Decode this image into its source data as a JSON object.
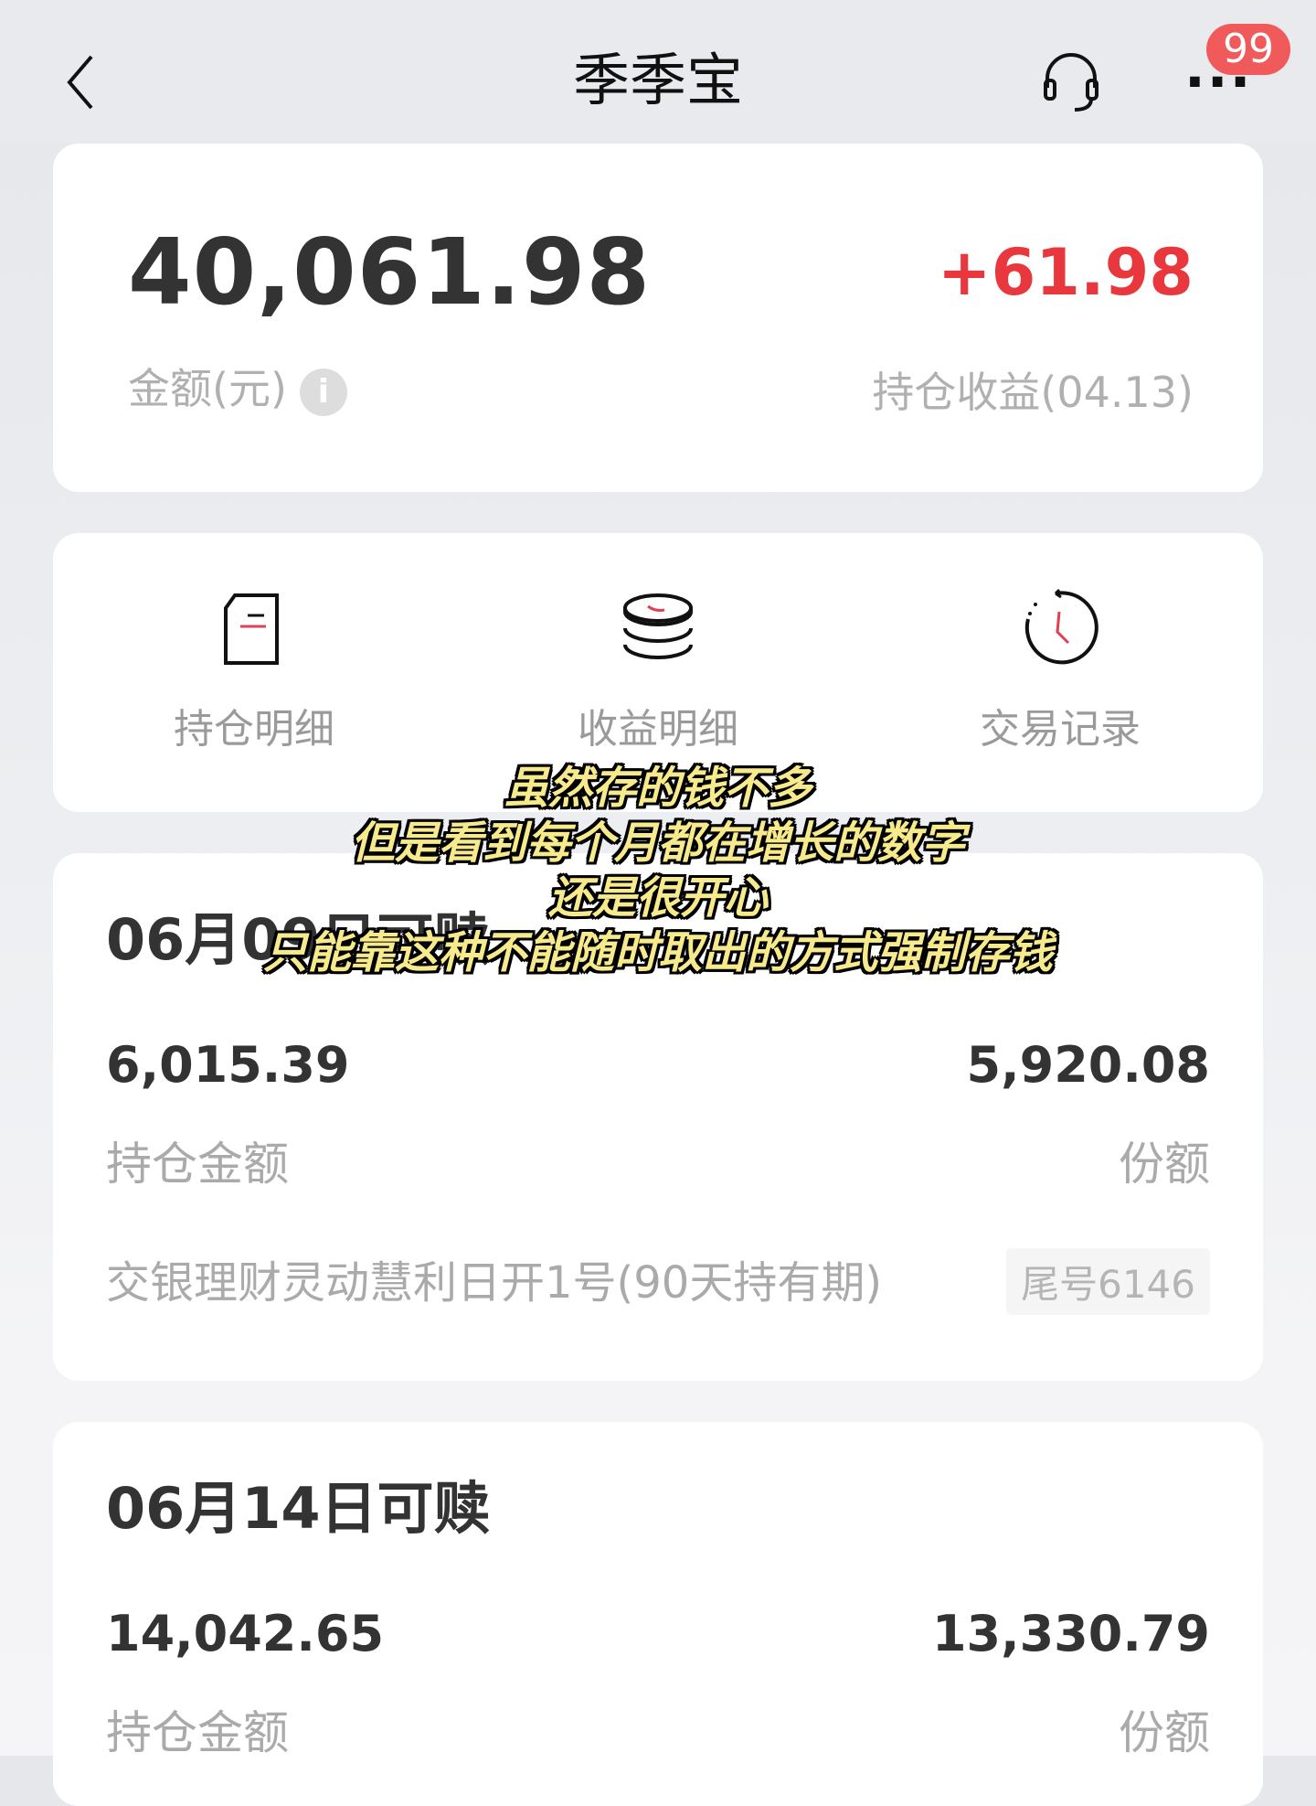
{
  "header": {
    "title": "季季宝",
    "badge": "99",
    "more": "···"
  },
  "summary": {
    "amount": "40,061.98",
    "amount_label": "金额(元)",
    "gain": "+61.98",
    "gain_label": "持仓收益(04.13)",
    "info": "i"
  },
  "actions": [
    {
      "label": "持仓明细",
      "icon": "document-icon"
    },
    {
      "label": "收益明细",
      "icon": "coins-stack-icon"
    },
    {
      "label": "交易记录",
      "icon": "clock-history-icon"
    }
  ],
  "holdings": [
    {
      "title": "06月09日可赎",
      "amount": "6,015.39",
      "amount_label": "持仓金额",
      "shares": "5,920.08",
      "shares_label": "份额",
      "product": "交银理财灵动慧利日开1号(90天持有期)",
      "tag": "尾号6146"
    },
    {
      "title": "06月14日可赎",
      "amount": "14,042.65",
      "amount_label": "持仓金额",
      "shares": "13,330.79",
      "shares_label": "份额"
    }
  ],
  "subtitles": [
    "虽然存的钱不多",
    "但是看到每个月都在增长的数字",
    "还是很开心",
    "只能靠这种不能随时取出的方式强制存钱"
  ],
  "colors": {
    "accent_red": "#e8383d",
    "badge": "#f05a5a",
    "subtitle": "#f7ea8c"
  }
}
